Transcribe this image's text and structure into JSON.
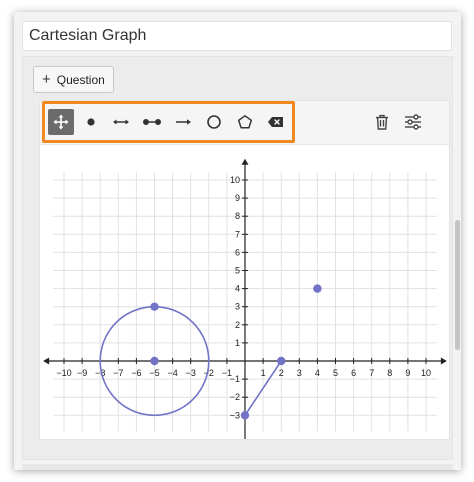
{
  "title": {
    "value": "Cartesian Graph"
  },
  "question_button": {
    "label": "Question",
    "icon": "plus-icon"
  },
  "toolbar": {
    "tools": [
      {
        "name": "move",
        "icon": "move-arrows-icon",
        "active": true
      },
      {
        "name": "point",
        "icon": "point-icon",
        "active": false
      },
      {
        "name": "line",
        "icon": "line-double-arrow-icon",
        "active": false
      },
      {
        "name": "segment",
        "icon": "segment-icon",
        "active": false
      },
      {
        "name": "ray",
        "icon": "ray-arrow-icon",
        "active": false
      },
      {
        "name": "circle",
        "icon": "circle-icon",
        "active": false
      },
      {
        "name": "polygon",
        "icon": "polygon-icon",
        "active": false
      },
      {
        "name": "delete",
        "icon": "delete-label-icon",
        "active": false
      }
    ],
    "right": [
      {
        "name": "trash",
        "icon": "trash-icon"
      },
      {
        "name": "settings",
        "icon": "sliders-icon"
      }
    ],
    "highlight_color": "#f0891f"
  },
  "graph": {
    "x_ticks": [
      "−10",
      "−9",
      "−8",
      "−7",
      "−6",
      "−5",
      "−4",
      "−3",
      "−2",
      "−1",
      "1",
      "2",
      "3",
      "4",
      "5",
      "6",
      "7",
      "8",
      "9",
      "10"
    ],
    "y_ticks": [
      "10",
      "9",
      "8",
      "7",
      "6",
      "5",
      "4",
      "3",
      "2",
      "1",
      "−1",
      "−2",
      "−3"
    ],
    "xlim": [
      -10,
      10
    ],
    "ylim": [
      -3,
      10
    ],
    "shape_color": "#7073c6",
    "points": [
      {
        "x": -5,
        "y": 3
      },
      {
        "x": -5,
        "y": 0
      },
      {
        "x": 4,
        "y": 4
      },
      {
        "x": 2,
        "y": 0
      },
      {
        "x": 0,
        "y": -3
      }
    ],
    "circle": {
      "center": [
        -5,
        0
      ],
      "radius": 3
    },
    "segment": {
      "from": [
        0,
        -3
      ],
      "to": [
        2,
        0
      ]
    }
  }
}
